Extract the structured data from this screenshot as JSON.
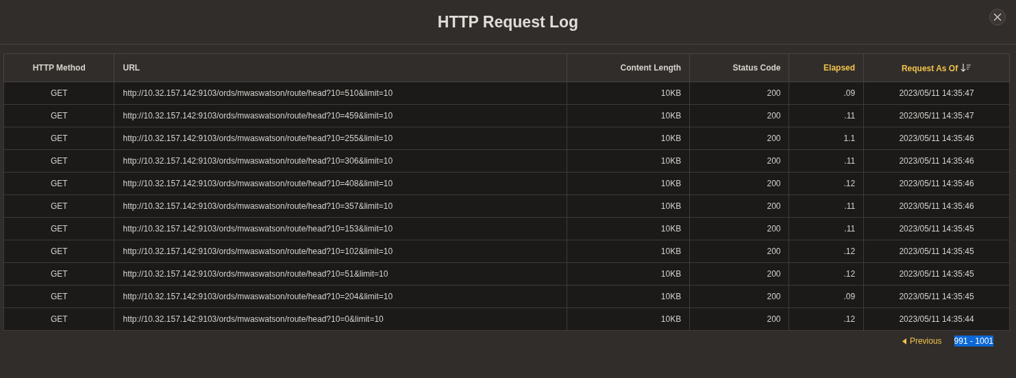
{
  "dialog": {
    "title": "HTTP Request Log"
  },
  "table": {
    "columns": [
      {
        "label": "HTTP Method",
        "highlighted": false,
        "sorted": false
      },
      {
        "label": "URL",
        "highlighted": false,
        "sorted": false
      },
      {
        "label": "Content Length",
        "highlighted": false,
        "sorted": false
      },
      {
        "label": "Status Code",
        "highlighted": false,
        "sorted": false
      },
      {
        "label": "Elapsed",
        "highlighted": true,
        "sorted": false
      },
      {
        "label": "Request As Of",
        "highlighted": true,
        "sorted": true
      }
    ],
    "rows": [
      [
        "GET",
        "http://10.32.157.142:9103/ords/mwaswatson/route/head?10=510&limit=10",
        "10KB",
        "200",
        ".09",
        "2023/05/11 14:35:47"
      ],
      [
        "GET",
        "http://10.32.157.142:9103/ords/mwaswatson/route/head?10=459&limit=10",
        "10KB",
        "200",
        ".11",
        "2023/05/11 14:35:47"
      ],
      [
        "GET",
        "http://10.32.157.142:9103/ords/mwaswatson/route/head?10=255&limit=10",
        "10KB",
        "200",
        "1.1",
        "2023/05/11 14:35:46"
      ],
      [
        "GET",
        "http://10.32.157.142:9103/ords/mwaswatson/route/head?10=306&limit=10",
        "10KB",
        "200",
        ".11",
        "2023/05/11 14:35:46"
      ],
      [
        "GET",
        "http://10.32.157.142:9103/ords/mwaswatson/route/head?10=408&limit=10",
        "10KB",
        "200",
        ".12",
        "2023/05/11 14:35:46"
      ],
      [
        "GET",
        "http://10.32.157.142:9103/ords/mwaswatson/route/head?10=357&limit=10",
        "10KB",
        "200",
        ".11",
        "2023/05/11 14:35:46"
      ],
      [
        "GET",
        "http://10.32.157.142:9103/ords/mwaswatson/route/head?10=153&limit=10",
        "10KB",
        "200",
        ".11",
        "2023/05/11 14:35:45"
      ],
      [
        "GET",
        "http://10.32.157.142:9103/ords/mwaswatson/route/head?10=102&limit=10",
        "10KB",
        "200",
        ".12",
        "2023/05/11 14:35:45"
      ],
      [
        "GET",
        "http://10.32.157.142:9103/ords/mwaswatson/route/head?10=51&limit=10",
        "10KB",
        "200",
        ".12",
        "2023/05/11 14:35:45"
      ],
      [
        "GET",
        "http://10.32.157.142:9103/ords/mwaswatson/route/head?10=204&limit=10",
        "10KB",
        "200",
        ".09",
        "2023/05/11 14:35:45"
      ],
      [
        "GET",
        "http://10.32.157.142:9103/ords/mwaswatson/route/head?10=0&limit=10",
        "10KB",
        "200",
        ".12",
        "2023/05/11 14:35:44"
      ]
    ]
  },
  "pagination": {
    "previous": "Previous",
    "range": "991 - 1001",
    "range_highlighted": true
  }
}
